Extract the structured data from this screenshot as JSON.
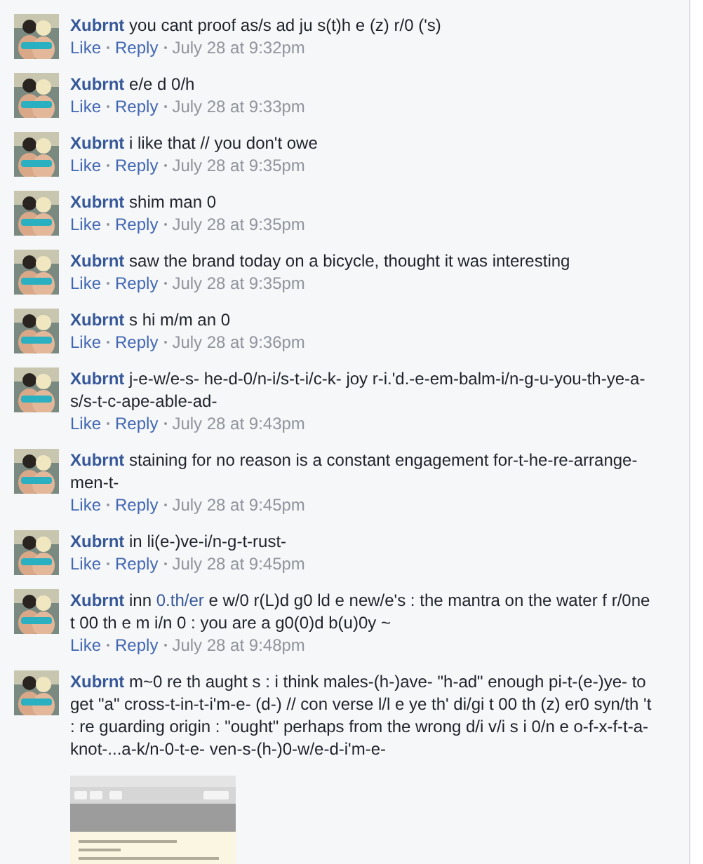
{
  "comments": [
    {
      "author": "Xubrnt",
      "text": [
        {
          "kind": "text",
          "text": "you cant proof as/s ad ju s(t)h e (z) r/0 ('s)"
        }
      ],
      "like": "Like",
      "reply": "Reply",
      "time": "July 28 at 9:32pm"
    },
    {
      "author": "Xubrnt",
      "text": [
        {
          "kind": "text",
          "text": "e/e d 0/h"
        }
      ],
      "like": "Like",
      "reply": "Reply",
      "time": "July 28 at 9:33pm"
    },
    {
      "author": "Xubrnt",
      "text": [
        {
          "kind": "text",
          "text": "i like that // you don't owe"
        }
      ],
      "like": "Like",
      "reply": "Reply",
      "time": "July 28 at 9:35pm"
    },
    {
      "author": "Xubrnt",
      "text": [
        {
          "kind": "text",
          "text": "shim man 0"
        }
      ],
      "like": "Like",
      "reply": "Reply",
      "time": "July 28 at 9:35pm"
    },
    {
      "author": "Xubrnt",
      "text": [
        {
          "kind": "text",
          "text": "saw the brand today on a bicycle, thought it was interesting"
        }
      ],
      "like": "Like",
      "reply": "Reply",
      "time": "July 28 at 9:35pm"
    },
    {
      "author": "Xubrnt",
      "text": [
        {
          "kind": "text",
          "text": "s hi m/m an 0"
        }
      ],
      "like": "Like",
      "reply": "Reply",
      "time": "July 28 at 9:36pm"
    },
    {
      "author": "Xubrnt",
      "text": [
        {
          "kind": "text",
          "text": "j-e-w/e-s- he-d-0/n-i/s-t-i/c-k- joy r-i.'d.-e-em-balm-i/n-g-u-you-th-ye-a-s/s-t-c-ape-able-ad-"
        }
      ],
      "like": "Like",
      "reply": "Reply",
      "time": "July 28 at 9:43pm"
    },
    {
      "author": "Xubrnt",
      "text": [
        {
          "kind": "text",
          "text": "staining for no reason is a constant engagement for-t-he-re-arrange-men-t-"
        }
      ],
      "like": "Like",
      "reply": "Reply",
      "time": "July 28 at 9:45pm"
    },
    {
      "author": "Xubrnt",
      "text": [
        {
          "kind": "text",
          "text": "in li(e-)ve-i/n-g-t-rust-"
        }
      ],
      "like": "Like",
      "reply": "Reply",
      "time": "July 28 at 9:45pm"
    },
    {
      "author": "Xubrnt",
      "text": [
        {
          "kind": "text",
          "text": "inn "
        },
        {
          "kind": "link",
          "text": "0.th/er"
        },
        {
          "kind": "text",
          "text": " e w/0 r(L)d g0 ld e new/e's : the mantra on the water f r/0ne t 00 th e m i/n 0 : you are a g0(0)d b(u)0y ~"
        }
      ],
      "like": "Like",
      "reply": "Reply",
      "time": "July 28 at 9:48pm"
    },
    {
      "author": "Xubrnt",
      "text": [
        {
          "kind": "text",
          "text": "m~0 re th aught s : i think males-(h-)ave- \"h-ad\" enough pi-t-(e-)ye- to get \"a\" cross-t-in-t-i'm-e- (d-) // con verse l/l e ye th' di/gi t 00 th (z) er0 syn/th 't : re guarding origin : \"ought\" perhaps from the wrong d/i v/i s i 0/n e o-f-x-f-t-a-knot-...a-k/n-0-t-e- ven-s-(h-)0-w/e-d-i'm-e-"
        }
      ]
    }
  ]
}
